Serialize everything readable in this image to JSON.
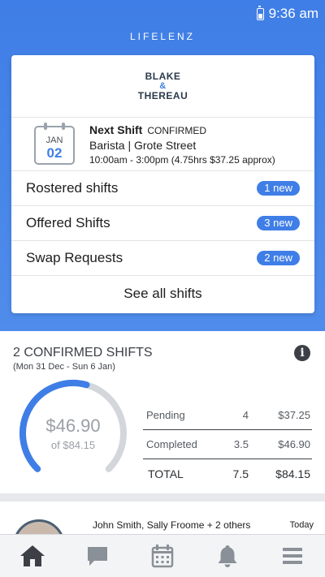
{
  "status_bar": {
    "time": "9:36 am",
    "battery_icon": "battery-icon"
  },
  "app": {
    "title": "LIFELENZ"
  },
  "brand": {
    "line1": "BLAKE",
    "amp": "&",
    "line2": "THEREAU"
  },
  "next_shift": {
    "month": "JAN",
    "day": "02",
    "title": "Next Shift",
    "status": "CONFIRMED",
    "role_location": "Barista | Grote Street",
    "time_details": "10:00am - 3:00pm (4.75hrs $37.25 approx)"
  },
  "shift_rows": [
    {
      "label": "Rostered shifts",
      "badge": "1 new"
    },
    {
      "label": "Offered Shifts",
      "badge": "3 new"
    },
    {
      "label": "Swap Requests",
      "badge": "2 new"
    }
  ],
  "see_all_label": "See all shifts",
  "summary": {
    "title": "2 CONFIRMED SHIFTS",
    "date_range": "(Mon 31 Dec - Sun 6 Jan)",
    "gauge_value": "$46.90",
    "gauge_total": "of $84.15",
    "gauge_fraction": 0.557,
    "rows": [
      {
        "label": "Pending",
        "qty": "4",
        "amount": "$37.25"
      },
      {
        "label": "Completed",
        "qty": "3.5",
        "amount": "$46.90"
      },
      {
        "label": "TOTAL",
        "qty": "7.5",
        "amount": "$84.15"
      }
    ]
  },
  "feed": {
    "names": "John Smith, Sally Froome + 2 others",
    "time": "Today"
  },
  "tabs": [
    {
      "icon": "home-icon"
    },
    {
      "icon": "chat-icon"
    },
    {
      "icon": "calendar-icon"
    },
    {
      "icon": "bell-icon"
    },
    {
      "icon": "menu-icon"
    }
  ],
  "colors": {
    "accent": "#3f7ee6",
    "hero_bg": "#4a88ea",
    "gauge_track": "#d3d6da",
    "icon": "#3c4046"
  }
}
